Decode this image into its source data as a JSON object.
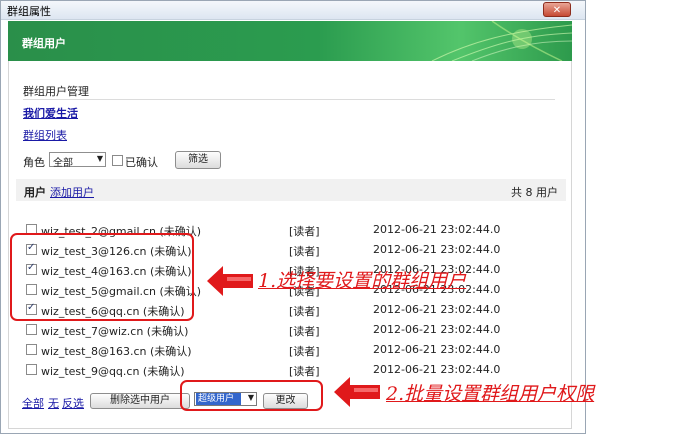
{
  "window": {
    "title": "群组属性",
    "close_label": "✕"
  },
  "banner": {
    "title": "群组用户"
  },
  "management": {
    "section_title": "群组用户管理",
    "group_link": "我们爱生活",
    "list_link": "群组列表",
    "role_label": "角色",
    "role_value": "全部",
    "confirmed_label": "已确认",
    "filter_button": "筛选"
  },
  "users_bar": {
    "label": "用户",
    "add_link": "添加用户",
    "count": "共 8 用户"
  },
  "users": [
    {
      "email": "wiz_test_2@gmail.cn (未确认)",
      "role": "[读者]",
      "time": "2012-06-21 23:02:44.0",
      "checked": false
    },
    {
      "email": "wiz_test_3@126.cn (未确认)",
      "role": "[读者]",
      "time": "2012-06-21 23:02:44.0",
      "checked": true
    },
    {
      "email": "wiz_test_4@163.cn (未确认)",
      "role": "[读者]",
      "time": "2012-06-21 23:02:44.0",
      "checked": true
    },
    {
      "email": "wiz_test_5@gmail.cn (未确认)",
      "role": "[读者]",
      "time": "2012-06-21 23:02:44.0",
      "checked": false
    },
    {
      "email": "wiz_test_6@qq.cn (未确认)",
      "role": "[读者]",
      "time": "2012-06-21 23:02:44.0",
      "checked": true
    },
    {
      "email": "wiz_test_7@wiz.cn (未确认)",
      "role": "[读者]",
      "time": "2012-06-21 23:02:44.0",
      "checked": false
    },
    {
      "email": "wiz_test_8@163.cn (未确认)",
      "role": "[读者]",
      "time": "2012-06-21 23:02:44.0",
      "checked": false
    },
    {
      "email": "wiz_test_9@qq.cn (未确认)",
      "role": "[读者]",
      "time": "2012-06-21 23:02:44.0",
      "checked": false
    }
  ],
  "footer": {
    "select_all": "全部",
    "select_none": "无",
    "select_invert": "反选",
    "delete_button": "删除选中用户",
    "role_select_value": "超级用户",
    "change_button": "更改"
  },
  "annotations": {
    "step1": "1.选择要设置的群组用户",
    "step2": "2.批量设置群组用户权限"
  },
  "colors": {
    "banner_green": "#2b9c4f",
    "annotation_red": "#e0191b",
    "link_blue": "#1a1aa6"
  }
}
